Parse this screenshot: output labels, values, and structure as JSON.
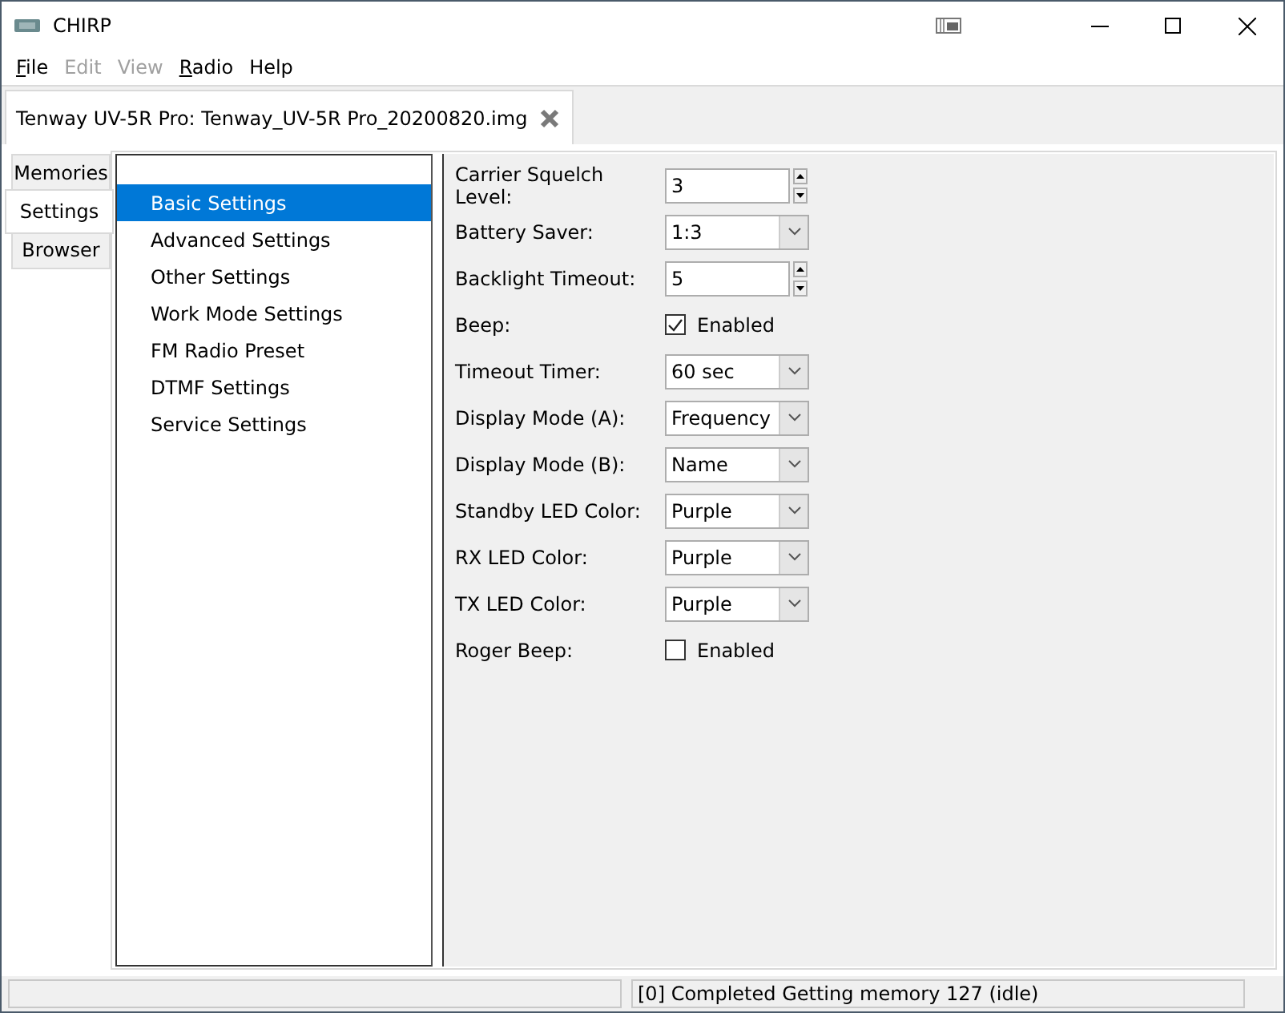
{
  "window": {
    "title": "CHIRP"
  },
  "menu": [
    {
      "label": "File",
      "disabled": false,
      "mnemonic": true
    },
    {
      "label": "Edit",
      "disabled": true,
      "mnemonic": false
    },
    {
      "label": "View",
      "disabled": true,
      "mnemonic": false
    },
    {
      "label": "Radio",
      "disabled": false,
      "mnemonic": true
    },
    {
      "label": "Help",
      "disabled": false,
      "mnemonic": false
    }
  ],
  "document_tab": {
    "label": "Tenway UV-5R Pro: Tenway_UV-5R Pro_20200820.img"
  },
  "side_tabs": [
    {
      "label": "Memories",
      "selected": false
    },
    {
      "label": "Settings",
      "selected": true
    },
    {
      "label": "Browser",
      "selected": false
    }
  ],
  "settings_tree": [
    {
      "label": "Basic Settings",
      "selected": true
    },
    {
      "label": "Advanced Settings",
      "selected": false
    },
    {
      "label": "Other Settings",
      "selected": false
    },
    {
      "label": "Work Mode Settings",
      "selected": false
    },
    {
      "label": "FM Radio Preset",
      "selected": false
    },
    {
      "label": "DTMF Settings",
      "selected": false
    },
    {
      "label": "Service Settings",
      "selected": false
    }
  ],
  "settings": [
    {
      "label": "Carrier Squelch Level:",
      "kind": "spin",
      "value": "3"
    },
    {
      "label": "Battery Saver:",
      "kind": "combo",
      "value": "1:3"
    },
    {
      "label": "Backlight Timeout:",
      "kind": "spin",
      "value": "5"
    },
    {
      "label": "Beep:",
      "kind": "check",
      "value": "Enabled",
      "checked": true
    },
    {
      "label": "Timeout Timer:",
      "kind": "combo",
      "value": "60 sec"
    },
    {
      "label": "Display Mode (A):",
      "kind": "combo",
      "value": "Frequency"
    },
    {
      "label": "Display Mode (B):",
      "kind": "combo",
      "value": "Name"
    },
    {
      "label": "Standby LED Color:",
      "kind": "combo",
      "value": "Purple"
    },
    {
      "label": "RX LED Color:",
      "kind": "combo",
      "value": "Purple"
    },
    {
      "label": "TX LED Color:",
      "kind": "combo",
      "value": "Purple"
    },
    {
      "label": "Roger Beep:",
      "kind": "check",
      "value": "Enabled",
      "checked": false
    }
  ],
  "status_bar": {
    "message": "[0] Completed Getting memory 127 (idle)"
  }
}
